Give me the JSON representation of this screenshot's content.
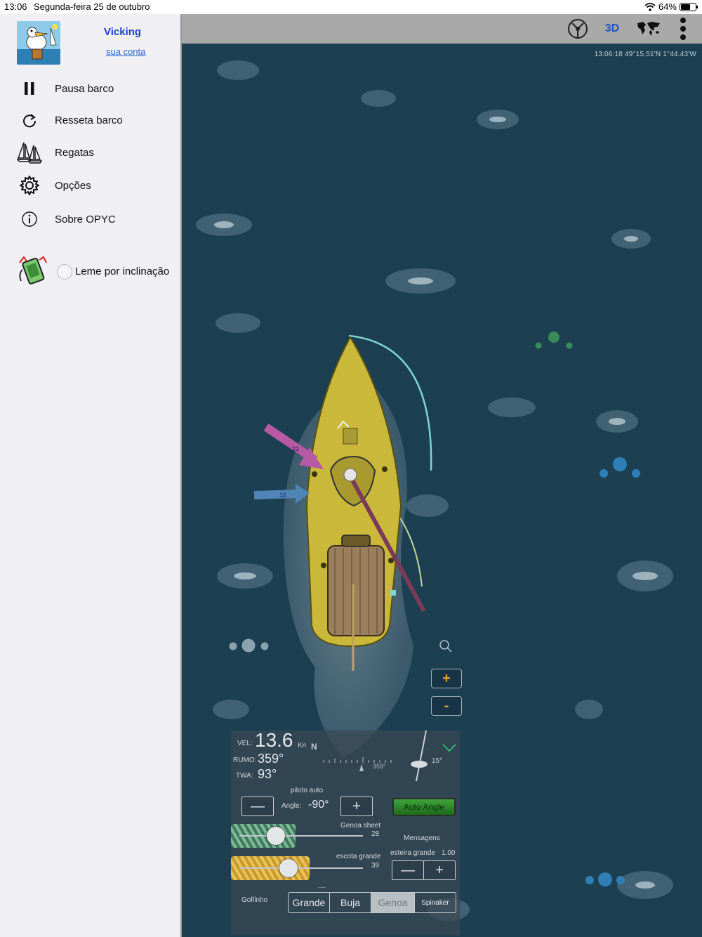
{
  "status": {
    "time": "13:06",
    "date": "Segunda-feira 25 de outubro",
    "battery": "64%",
    "battery_level": 0.64
  },
  "sidebar": {
    "user_name": "Vicking",
    "account_link": "sua conta",
    "items": [
      {
        "label": "Pausa barco",
        "icon": "pause-icon"
      },
      {
        "label": "Resseta barco",
        "icon": "reset-icon"
      },
      {
        "label": "Regatas",
        "icon": "sailboats-icon"
      },
      {
        "label": "Opções",
        "icon": "gear-icon"
      },
      {
        "label": "Sobre OPYC",
        "icon": "info-icon"
      }
    ],
    "tilt_label": "Leme por inclinação"
  },
  "toolbar": {
    "view_3d": "3D"
  },
  "map": {
    "coords": "13:06:18  49°15.51'N   1°44.43'W",
    "true_wind_label": "21",
    "apparent_wind_label": "16",
    "zoom_in": "+",
    "zoom_out": "-"
  },
  "instruments": {
    "vel_label": "VEL:",
    "vel_value": "13.6",
    "vel_unit": "Kn",
    "rumo_label": "RUMO:",
    "rumo_value": "359°",
    "twa_label": "TWA:",
    "twa_value": "93°",
    "compass_n": "N",
    "compass_heading": "359°",
    "heel": "15°"
  },
  "autopilot": {
    "title": "piloto auto",
    "angle_label": "Angle:",
    "angle_value": "-90°",
    "minus": "—",
    "plus": "+",
    "auto_angle": "Auto Angle"
  },
  "sheets": {
    "genoa_label": "Genoa sheet",
    "genoa_value": "28",
    "main_label": "escota grande",
    "main_value": "39",
    "messages": "Mensagens",
    "traveller_label": "esteira grande",
    "traveller_value": "1.00",
    "dots": "...."
  },
  "sails": {
    "dolphin": "Golfinho",
    "tabs": [
      "Grande",
      "Buja",
      "Genoa",
      "Spinaker"
    ],
    "selected": "Genoa"
  }
}
